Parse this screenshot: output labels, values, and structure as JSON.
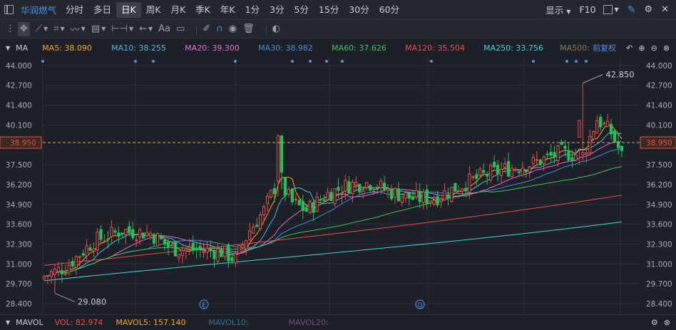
{
  "topbar": {
    "stock_name": "华润燃气",
    "tabs": [
      {
        "label": "分时",
        "active": false
      },
      {
        "label": "多日",
        "active": false
      },
      {
        "label": "日K",
        "active": true
      },
      {
        "label": "周K",
        "active": false
      },
      {
        "label": "月K",
        "active": false
      },
      {
        "label": "季K",
        "active": false
      },
      {
        "label": "年K",
        "active": false
      },
      {
        "label": "1分",
        "active": false
      },
      {
        "label": "3分",
        "active": false
      },
      {
        "label": "5分",
        "active": false
      },
      {
        "label": "15分",
        "active": false
      },
      {
        "label": "30分",
        "active": false
      },
      {
        "label": "60分",
        "active": false
      }
    ],
    "display_label": "显示",
    "f10_label": "F10"
  },
  "toolbar": {
    "text_tool_label": "Aa"
  },
  "ma_bar": {
    "label": "MA",
    "items": [
      {
        "label": "MA5: 38.090",
        "color": "#f5a623"
      },
      {
        "label": "MA10: 38.255",
        "color": "#4db8e8"
      },
      {
        "label": "MA20: 39.300",
        "color": "#e66bd6"
      },
      {
        "label": "MA30: 38.982",
        "color": "#3d8fe0"
      },
      {
        "label": "MA60: 37.626",
        "color": "#3fc45b"
      },
      {
        "label": "MA120: 35.504",
        "color": "#e94e4e"
      },
      {
        "label": "MA250: 33.756",
        "color": "#3ed6e0"
      },
      {
        "label": "MA500:",
        "color": "#8a7a4a"
      }
    ],
    "adjust_label": "前复权"
  },
  "volume_bar": {
    "label": "MAVOL",
    "vol": {
      "label": "VOL: 82.974",
      "color": "#e94e4e"
    },
    "mavol5": {
      "label": "MAVOL5: 157.140",
      "color": "#f5a623"
    },
    "mavol10": {
      "label": "MAVOL10:",
      "color": "#3a6f8a"
    },
    "mavol20": {
      "label": "MAVOL20:",
      "color": "#7a4a7a"
    }
  },
  "chart_data": {
    "type": "candlestick",
    "y_ticks": [
      "44.000",
      "42.700",
      "41.400",
      "40.100",
      "38.950",
      "37.500",
      "36.200",
      "34.900",
      "33.600",
      "32.300",
      "31.000",
      "29.700",
      "28.400"
    ],
    "ylim": [
      27.7,
      44.6
    ],
    "current_price": "38.950",
    "max_label": "42.850",
    "min_label": "29.080",
    "event_markers": [
      "E",
      "Q"
    ],
    "colors": {
      "up": "#e94e4e",
      "down": "#21c25a",
      "grid": "#2b2f36"
    }
  }
}
